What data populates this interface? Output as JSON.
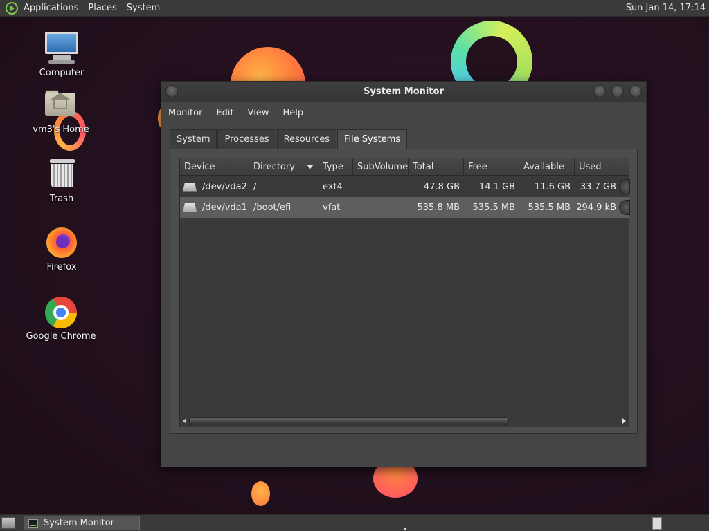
{
  "top_panel": {
    "menus": [
      "Applications",
      "Places",
      "System"
    ],
    "clock": "Sun Jan 14, 17:14"
  },
  "desktop_icons": [
    {
      "label": "Computer",
      "icon": "computer-icon"
    },
    {
      "label": "vm3's Home",
      "icon": "home-folder-icon"
    },
    {
      "label": "Trash",
      "icon": "trash-icon"
    },
    {
      "label": "Firefox",
      "icon": "firefox-icon"
    },
    {
      "label": "Google Chrome",
      "icon": "chrome-icon"
    }
  ],
  "window": {
    "title": "System Monitor",
    "menubar": [
      "Monitor",
      "Edit",
      "View",
      "Help"
    ],
    "tabs": [
      "System",
      "Processes",
      "Resources",
      "File Systems"
    ],
    "active_tab": "File Systems",
    "table": {
      "columns": [
        "Device",
        "Directory",
        "Type",
        "SubVolume",
        "Total",
        "Free",
        "Available",
        "Used"
      ],
      "sorted_column": "Directory",
      "rows": [
        {
          "device": "/dev/vda2",
          "directory": "/",
          "type": "ext4",
          "subvolume": "",
          "total": "47.8 GB",
          "free": "14.1 GB",
          "available": "11.6 GB",
          "used": "33.7 GB"
        },
        {
          "device": "/dev/vda1",
          "directory": "/boot/efi",
          "type": "vfat",
          "subvolume": "",
          "total": "535.8 MB",
          "free": "535.5 MB",
          "available": "535.5 MB",
          "used": "294.9 kB"
        }
      ],
      "selected_row": 1
    }
  },
  "taskbar": {
    "tasks": [
      "System Monitor"
    ]
  },
  "colors": {
    "panel": "#3a3a3a",
    "window_bg": "#454545",
    "selected_row": "#5e5e5e",
    "desktop": "#22101d"
  }
}
